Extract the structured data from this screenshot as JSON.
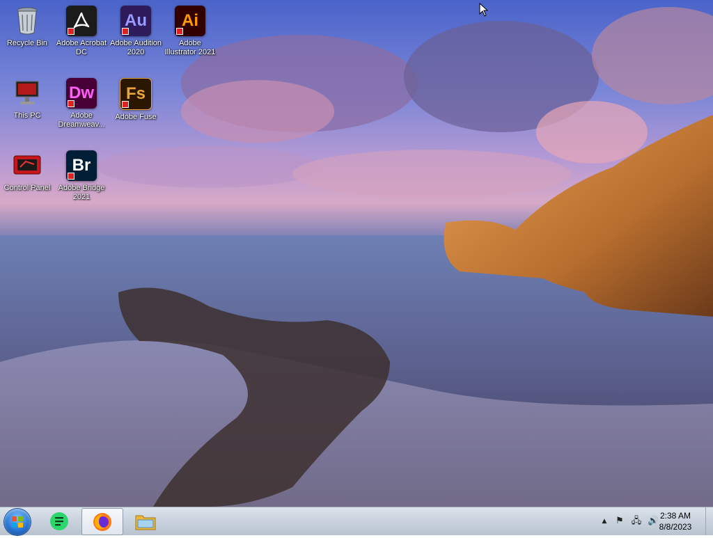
{
  "desktop": {
    "icons": [
      {
        "name": "recycle-bin-icon",
        "label": "Recycle Bin"
      },
      {
        "name": "acrobat-icon",
        "label": "Adobe Acrobat DC",
        "glyph": "",
        "color": "#1b1b1b"
      },
      {
        "name": "audition-icon",
        "label": "Adobe Audition 2020",
        "glyph": "Au",
        "color": "#2d1b5c",
        "fg": "#9a9aff"
      },
      {
        "name": "illustrator-icon",
        "label": "Adobe Illustrator 2021",
        "glyph": "Ai",
        "color": "#330000",
        "fg": "#ff9a00"
      },
      {
        "name": "this-pc-icon",
        "label": "This PC"
      },
      {
        "name": "dreamweaver-icon",
        "label": "Adobe Dreamweav...",
        "glyph": "Dw",
        "color": "#470137",
        "fg": "#ff61f6"
      },
      {
        "name": "fuse-icon",
        "label": "Adobe Fuse",
        "glyph": "Fs",
        "color": "#2b1700",
        "fg": "#e8a63a"
      },
      {
        "name": "control-panel-icon",
        "label": "Control Panel"
      },
      {
        "name": "bridge-icon",
        "label": "Adobe Bridge 2021",
        "glyph": "Br",
        "color": "#001e36",
        "fg": "#ffffff"
      }
    ]
  },
  "taskbar": {
    "clock_time": "2:38 AM",
    "clock_date": "8/8/2023",
    "tray_up_arrow": "▲",
    "tray_flag": "⚑",
    "tray_network": "🖧",
    "tray_volume": "🔊"
  }
}
